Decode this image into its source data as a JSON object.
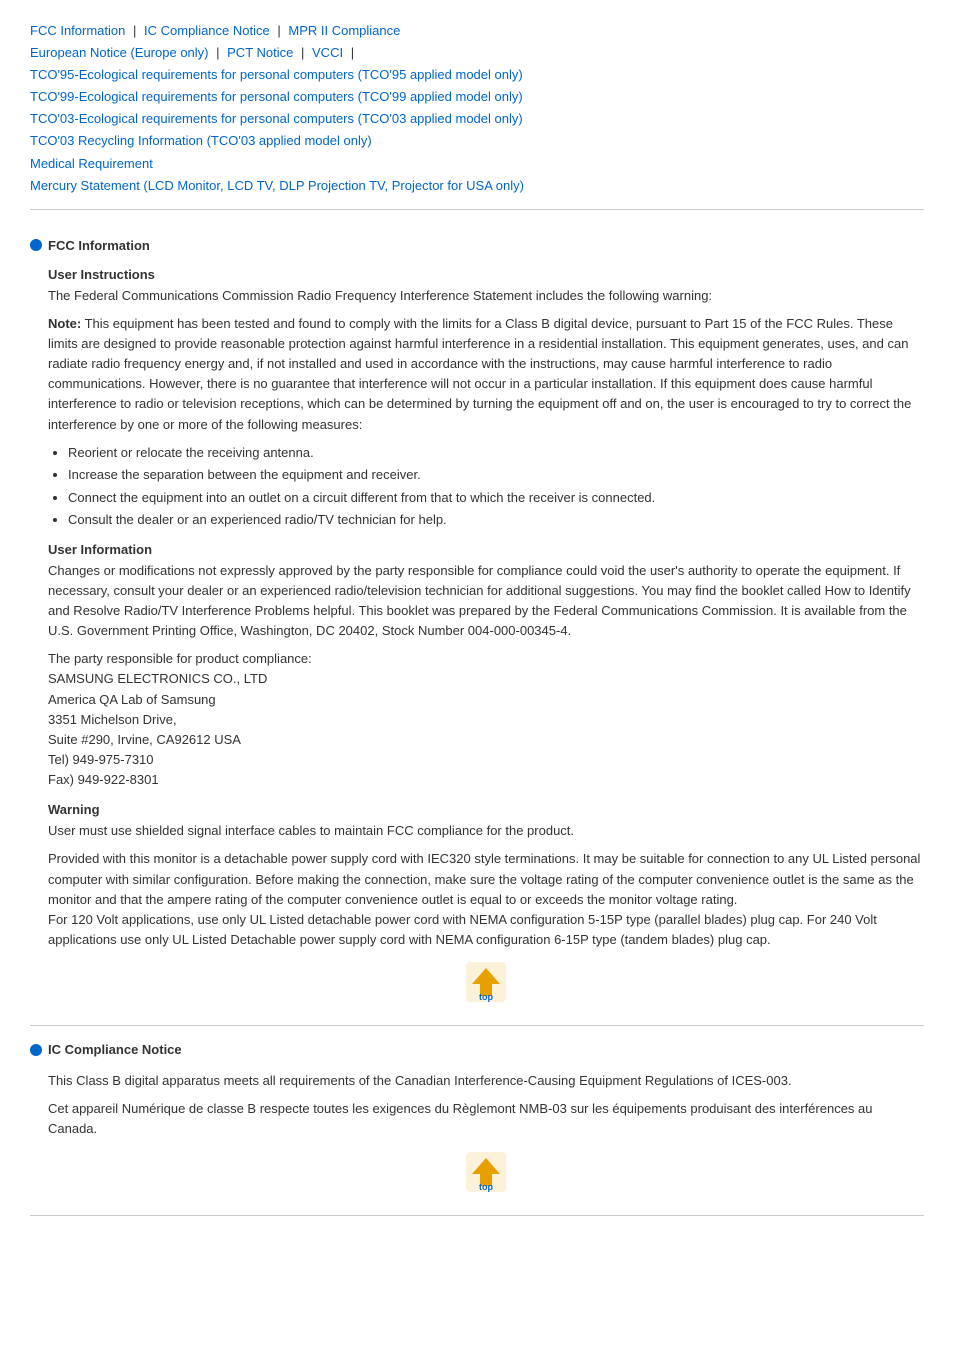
{
  "nav": {
    "links": [
      {
        "label": "FCC Information",
        "href": "#fcc"
      },
      {
        "label": "IC Compliance Notice",
        "href": "#ic"
      },
      {
        "label": "MPR II Compliance",
        "href": "#mpr"
      },
      {
        "label": "European Notice (Europe only)",
        "href": "#eu"
      },
      {
        "label": "PCT Notice",
        "href": "#pct"
      },
      {
        "label": "VCCI",
        "href": "#vcci"
      },
      {
        "label": "TCO'95-Ecological requirements for personal computers (TCO'95 applied model only)",
        "href": "#tco95"
      },
      {
        "label": "TCO'99-Ecological requirements for personal computers (TCO'99 applied model only)",
        "href": "#tco99"
      },
      {
        "label": "TCO'03-Ecological requirements for personal computers (TCO'03 applied model only)",
        "href": "#tco03"
      },
      {
        "label": "TCO'03 Recycling Information (TCO'03 applied model only)",
        "href": "#tco03r"
      },
      {
        "label": "Medical Requirement",
        "href": "#medical"
      },
      {
        "label": "Mercury Statement (LCD Monitor, LCD TV, DLP Projection TV, Projector for USA only)",
        "href": "#mercury"
      }
    ]
  },
  "sections": [
    {
      "id": "fcc",
      "title": "FCC Information",
      "subsections": [
        {
          "heading": "User Instructions",
          "paragraphs": [
            "The Federal Communications Commission Radio Frequency Interference Statement includes the following warning:"
          ],
          "bold_para": "Note: This equipment has been tested and found to comply with the limits for a Class B digital device, pursuant to Part 15 of the FCC Rules. These limits are designed to provide reasonable protection against harmful interference in a residential installation. This equipment generates, uses, and can radiate radio frequency energy and, if not installed and used in accordance with the instructions, may cause harmful interference to radio communications. However, there is no guarantee that interference will not occur in a particular installation. If this equipment does cause harmful interference to radio or television receptions, which can be determined by turning the equipment off and on, the user is encouraged to try to correct the interference by one or more of the following measures:",
          "bullets": [
            "Reorient or relocate the receiving antenna.",
            "Increase the separation between the equipment and receiver.",
            "Connect the equipment into an outlet on a circuit different from that to which the receiver is connected.",
            "Consult the dealer or an experienced radio/TV technician for help."
          ]
        },
        {
          "heading": "User Information",
          "paragraphs": [
            "Changes or modifications not expressly approved by the party responsible for compliance could void the user's authority to operate the equipment. If necessary, consult your dealer or an experienced radio/television technician for additional suggestions. You may find the booklet called How to Identify and Resolve Radio/TV Interference Problems helpful. This booklet was prepared by the Federal Communications Commission. It is available from the U.S. Government Printing Office, Washington, DC 20402, Stock Number 004-000-00345-4.",
            "The party responsible for product compliance:\nSAMSUNG ELECTRONICS CO., LTD\nAmerica QA Lab of Samsung\n3351 Michelson Drive,\nSuite #290, Irvine, CA92612 USA\nTel) 949-975-7310\nFax) 949-922-8301"
          ]
        },
        {
          "heading": "Warning",
          "paragraphs": [
            "User must use shielded signal interface cables to maintain FCC compliance for the product.",
            "Provided with this monitor is a detachable power supply cord with IEC320 style terminations. It may be suitable for connection to any UL Listed personal computer with similar configuration. Before making the connection, make sure the voltage rating of the computer convenience outlet is the same as the monitor and that the ampere rating of the computer convenience outlet is equal to or exceeds the monitor voltage rating.\nFor 120 Volt applications, use only UL Listed detachable power cord with NEMA configuration 5-15P type (parallel blades) plug cap. For 240 Volt applications use only UL Listed Detachable power supply cord with NEMA configuration 6-15P type (tandem blades) plug cap."
          ]
        }
      ]
    },
    {
      "id": "ic",
      "title": "IC Compliance Notice",
      "subsections": [
        {
          "heading": "",
          "paragraphs": [
            "This Class B digital apparatus meets all requirements of the Canadian Interference-Causing Equipment Regulations of ICES-003.",
            "Cet appareil Numérique de classe B respecte toutes les exigences du Règlemont NMB-03 sur les équipements produisant des interférences au Canada."
          ]
        }
      ]
    }
  ],
  "top_button_label": "Top"
}
